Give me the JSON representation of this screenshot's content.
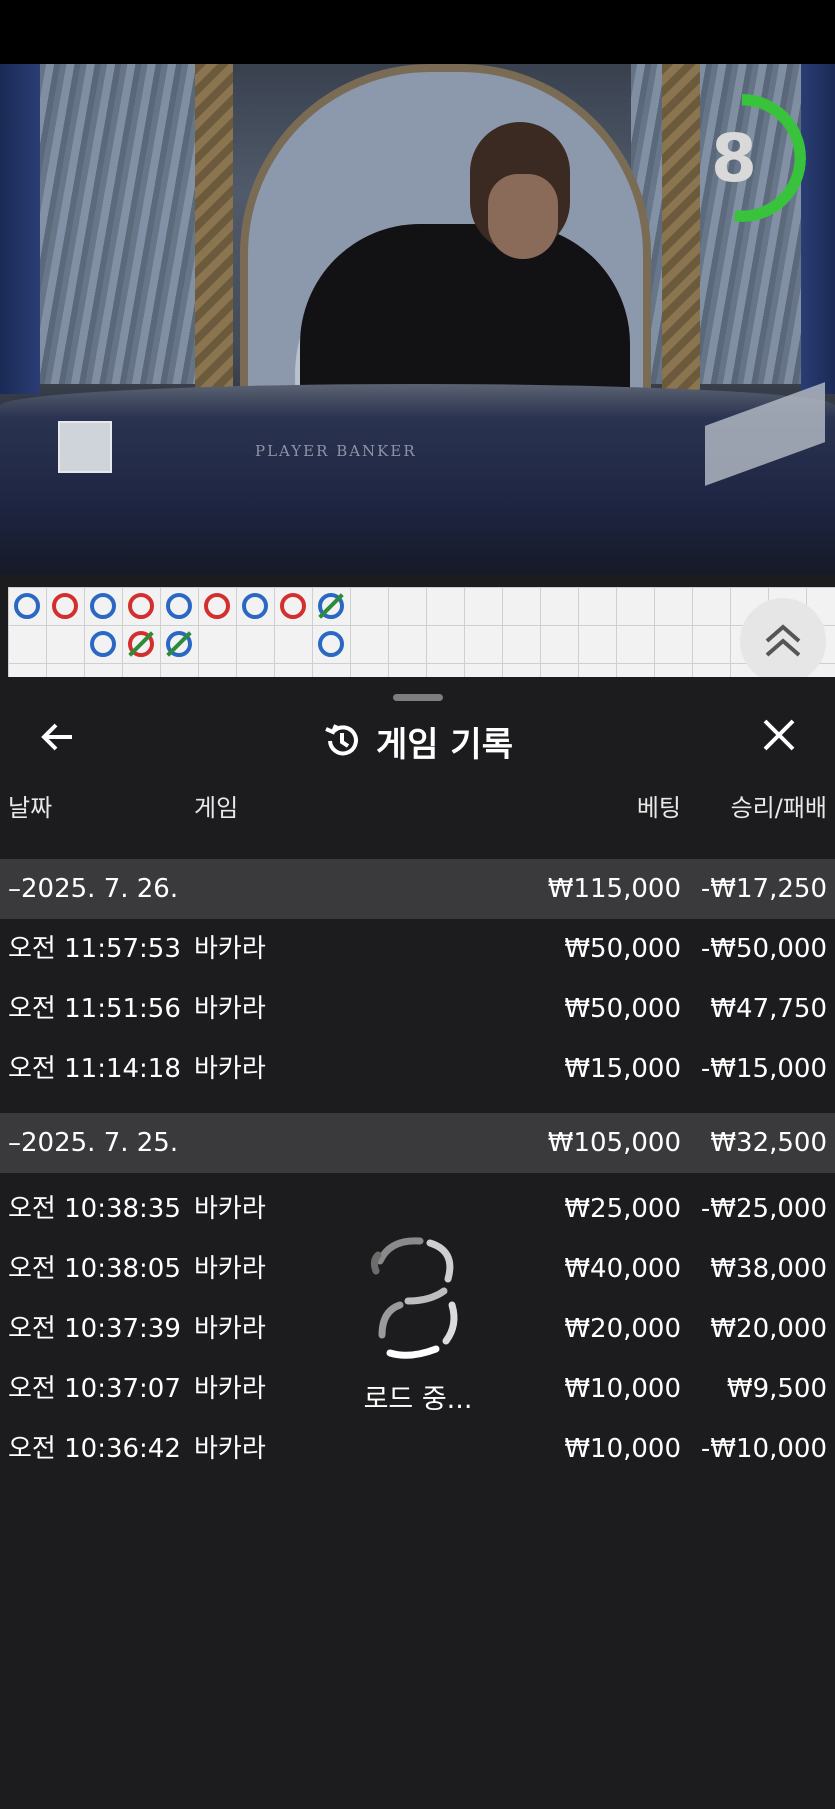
{
  "timer": {
    "value": "8",
    "progress": 0.52
  },
  "sheet": {
    "title": "게임 기록",
    "columns": {
      "date": "날짜",
      "game": "게임",
      "bet": "베팅",
      "result": "승리/패배"
    },
    "groups": [
      {
        "date": "–2025. 7. 26.",
        "bet": "₩115,000",
        "result": "-₩17,250",
        "rows": [
          {
            "time": "오전 11:57:53",
            "game": "바카라",
            "bet": "₩50,000",
            "result": "-₩50,000"
          },
          {
            "time": "오전 11:51:56",
            "game": "바카라",
            "bet": "₩50,000",
            "result": "₩47,750"
          },
          {
            "time": "오전 11:14:18",
            "game": "바카라",
            "bet": "₩15,000",
            "result": "-₩15,000"
          }
        ]
      },
      {
        "date": "–2025. 7. 25.",
        "bet": "₩105,000",
        "result": "₩32,500",
        "rows": [
          {
            "time": "오전 10:38:35",
            "game": "바카라",
            "bet": "₩25,000",
            "result": "-₩25,000"
          },
          {
            "time": "오전 10:38:05",
            "game": "바카라",
            "bet": "₩40,000",
            "result": "₩38,000"
          },
          {
            "time": "오전 10:37:39",
            "game": "바카라",
            "bet": "₩20,000",
            "result": "₩20,000"
          },
          {
            "time": "오전 10:37:07",
            "game": "바카라",
            "bet": "₩10,000",
            "result": "₩9,500"
          },
          {
            "time": "오전 10:36:42",
            "game": "바카라",
            "bet": "₩10,000",
            "result": "-₩10,000"
          }
        ]
      }
    ],
    "loading_text": "로드 중..."
  },
  "video": {
    "table_text": "PLAYER     BANKER"
  },
  "colors": {
    "player": "#2b68c4",
    "banker": "#d32f2f",
    "tie": "#2e8b3a",
    "timer": "#39c23b"
  }
}
